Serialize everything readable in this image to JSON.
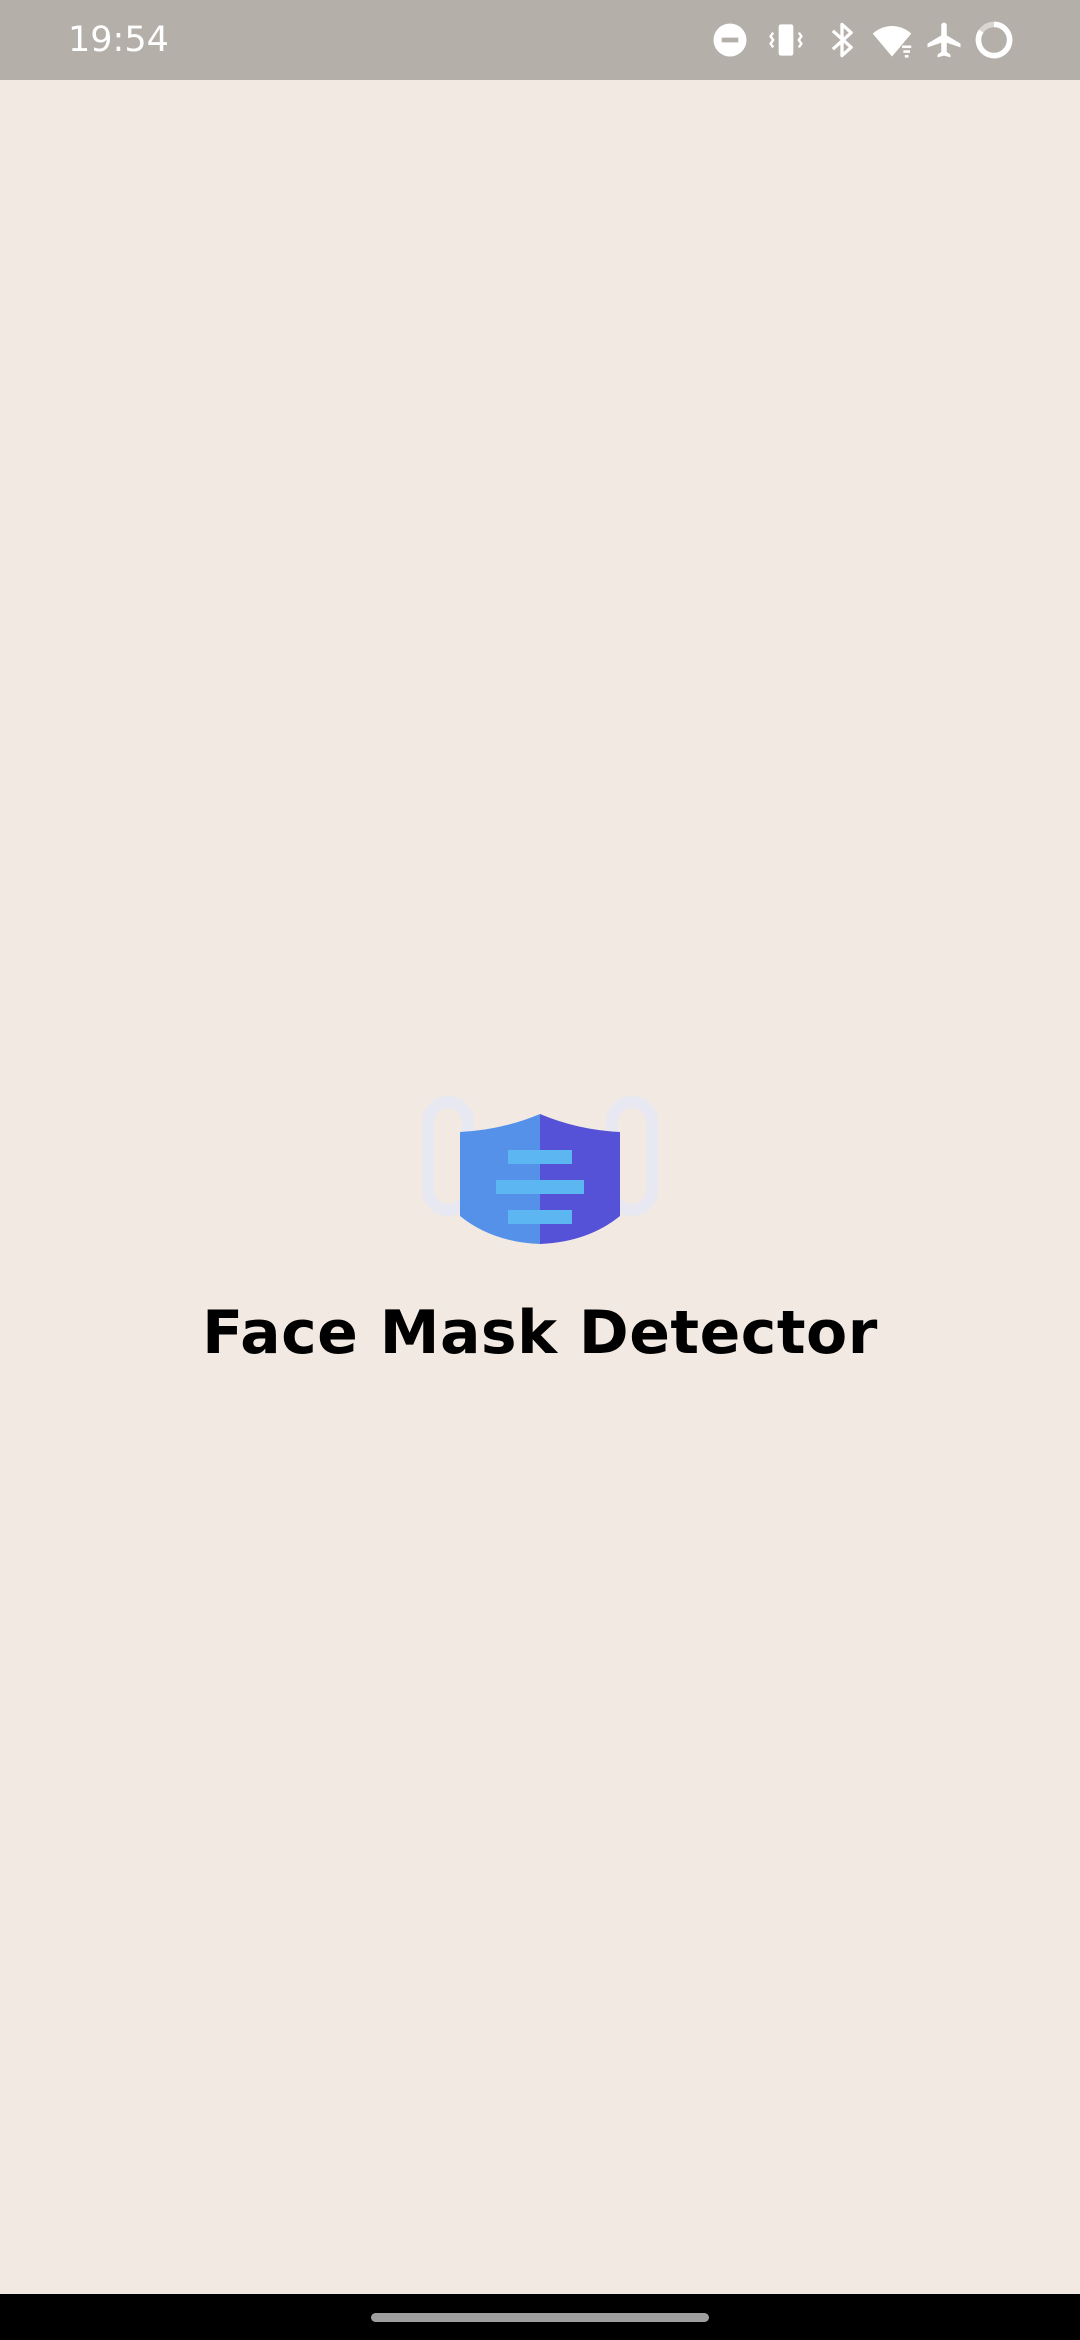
{
  "status_bar": {
    "time": "19:54",
    "icons": [
      "do-not-disturb-icon",
      "vibrate-icon",
      "bluetooth-icon",
      "wifi-icon",
      "airplane-mode-icon",
      "battery-icon"
    ],
    "background": "#B5AFA9"
  },
  "splash": {
    "background": "#F2EAE2",
    "logo_icon": "face-mask-icon",
    "title": "Face Mask Detector"
  },
  "navigation": {
    "gesture_handle": "home-gesture-handle"
  }
}
